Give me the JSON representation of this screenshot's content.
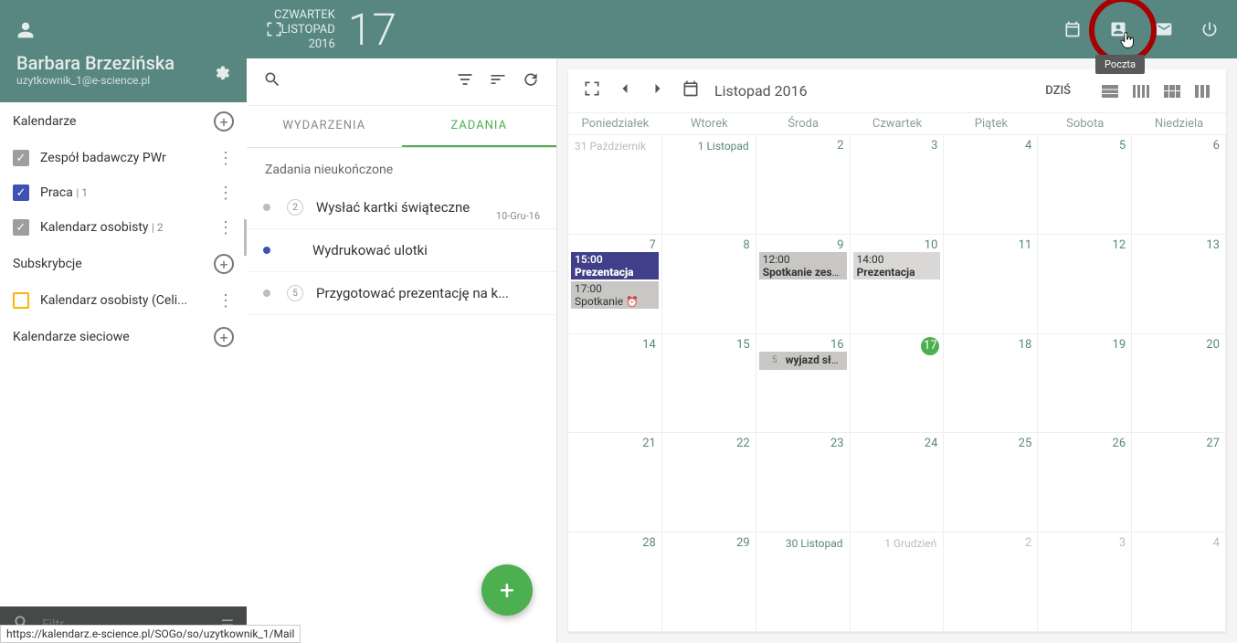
{
  "header": {
    "weekday": "CZWARTEK",
    "month": "LISTOPAD",
    "year": "2016",
    "bigday": "17",
    "tooltip": "Poczta"
  },
  "user": {
    "name": "Barbara Brzezińska",
    "email": "uzytkownik_1@e-science.pl"
  },
  "sections": {
    "calendars": "Kalendarze",
    "subs": "Subskrybcje",
    "netcals": "Kalendarze sieciowe"
  },
  "cals": [
    {
      "label": "Zespół badawczy PWr"
    },
    {
      "label": "Praca",
      "count": "1"
    },
    {
      "label": "Kalendarz osobisty",
      "count": "2"
    }
  ],
  "subs_items": [
    {
      "label": "Kalendarz osobisty (Celi..."
    }
  ],
  "filter_placeholder": "Filtr",
  "tabs": {
    "events": "WYDARZENIA",
    "tasks": "ZADANIA"
  },
  "tasks_header": "Zadania nieukończone",
  "tasks": [
    {
      "count": "2",
      "label": "Wysłać kartki świąteczne",
      "date": "10-Gru-16"
    },
    {
      "label": "Wydrukować ulotki"
    },
    {
      "count": "5",
      "label": "Przygotować prezentację na k..."
    }
  ],
  "cal": {
    "title": "Listopad 2016",
    "today": "DZIŚ",
    "days": [
      "Poniedziałek",
      "Wtorek",
      "Środa",
      "Czwartek",
      "Piątek",
      "Sobota",
      "Niedziela"
    ],
    "prev_month": "31 Październik",
    "first": "1 Listopad",
    "nums_r1": [
      "2",
      "3",
      "4",
      "5",
      "6"
    ],
    "nums_r2": [
      "7",
      "8",
      "9",
      "10",
      "11",
      "12",
      "13"
    ],
    "nums_r3": [
      "14",
      "15",
      "16",
      "17",
      "18",
      "19",
      "20"
    ],
    "nums_r4": [
      "21",
      "22",
      "23",
      "24",
      "25",
      "26",
      "27"
    ],
    "nums_r5": [
      "28",
      "29"
    ],
    "last": "30 Listopad",
    "next_month": "1 Grudzień",
    "next_nums": [
      "2",
      "3",
      "4"
    ],
    "events": {
      "d7a": {
        "time": "15:00",
        "title": "Prezentacja"
      },
      "d7b": {
        "time": "17:00",
        "title": "Spotkanie"
      },
      "d9": {
        "time": "12:00",
        "title": "Spotkanie zespołu"
      },
      "d10": {
        "time": "14:00",
        "title": "Prezentacja"
      },
      "d16": {
        "count": "5",
        "title": "wyjazd służbowy"
      }
    }
  },
  "status_url": "https://kalendarz.e-science.pl/SOGo/so/uzytkownik_1/Mail"
}
